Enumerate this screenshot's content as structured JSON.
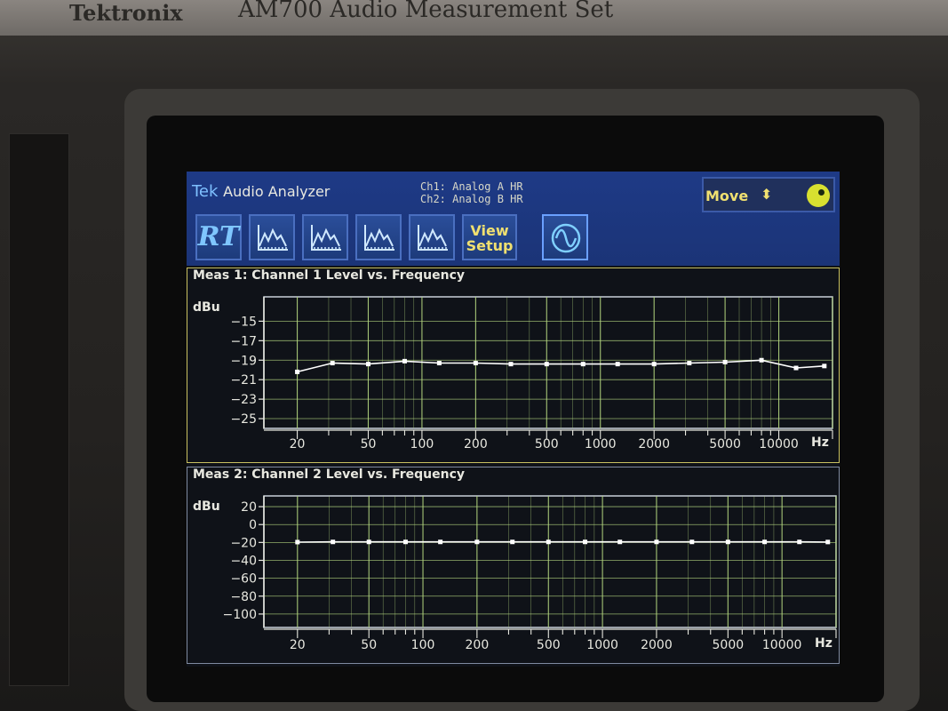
{
  "device": {
    "brand": "Tektronix",
    "model": "AM700 Audio Measurement Set"
  },
  "app": {
    "title_brand": "Tek",
    "title_name": "Audio Analyzer",
    "ch1": "Ch1: Analog A HR",
    "ch2": "Ch2: Analog B HR",
    "move_label": "Move",
    "move_icon": "up-down-arrows-icon",
    "knob_icon": "knob-icon",
    "colors": {
      "header": "#1e3a86",
      "accent": "#f0e070",
      "grid": "#b5d880",
      "trace": "#ffffff",
      "panel_active": "#c9c060"
    }
  },
  "toolbar": {
    "rt_label": "RT",
    "graph_buttons": [
      "graph-1-icon",
      "graph-2-icon",
      "graph-3-icon",
      "graph-4-icon"
    ],
    "view_setup_label_1": "View",
    "view_setup_label_2": "Setup",
    "sine_icon": "sine-wave-icon"
  },
  "chart_data": [
    {
      "type": "line",
      "title": "Meas 1: Channel 1 Level vs. Frequency",
      "ylabel": "dBu",
      "xlabel": "Hz",
      "xscale": "log",
      "xlim": [
        13,
        20000
      ],
      "ylim": [
        -26,
        -12.5
      ],
      "yticks": [
        -15,
        -17,
        -19,
        -21,
        -23,
        -25
      ],
      "xticks": [
        20,
        50,
        100,
        200,
        500,
        1000,
        2000,
        5000,
        10000
      ],
      "grid": true,
      "series": [
        {
          "x": [
            20,
            31.5,
            50,
            80,
            125,
            200,
            315,
            500,
            800,
            1250,
            2000,
            3150,
            5000,
            8000,
            12500,
            18000
          ],
          "y": [
            -20.2,
            -19.3,
            -19.4,
            -19.1,
            -19.3,
            -19.3,
            -19.4,
            -19.4,
            -19.4,
            -19.4,
            -19.4,
            -19.3,
            -19.2,
            -19.0,
            -19.8,
            -19.6
          ]
        }
      ]
    },
    {
      "type": "line",
      "title": "Meas 2: Channel 2 Level vs. Frequency",
      "ylabel": "dBu",
      "xlabel": "Hz",
      "xscale": "log",
      "xlim": [
        13,
        20000
      ],
      "ylim": [
        -115,
        32
      ],
      "yticks": [
        20,
        0,
        -20,
        -40,
        -60,
        -80,
        -100
      ],
      "xticks": [
        20,
        50,
        100,
        200,
        500,
        1000,
        2000,
        5000,
        10000
      ],
      "grid": true,
      "series": [
        {
          "x": [
            20,
            31.5,
            50,
            80,
            125,
            200,
            315,
            500,
            800,
            1250,
            2000,
            3150,
            5000,
            8000,
            12500,
            18000
          ],
          "y": [
            -19.6,
            -19.4,
            -19.4,
            -19.4,
            -19.4,
            -19.4,
            -19.4,
            -19.4,
            -19.4,
            -19.4,
            -19.4,
            -19.4,
            -19.4,
            -19.4,
            -19.4,
            -19.5
          ]
        }
      ]
    }
  ]
}
